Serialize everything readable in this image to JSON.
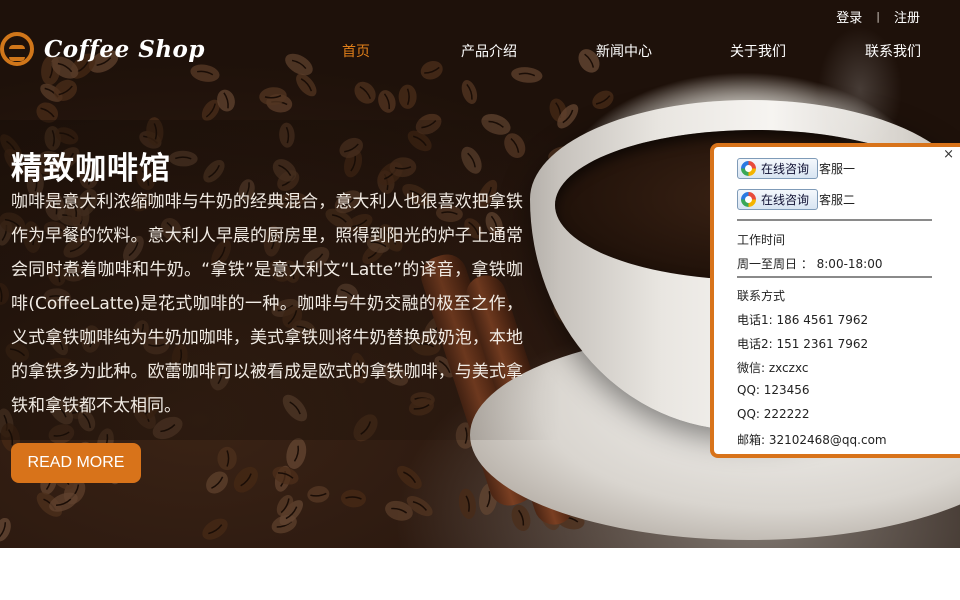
{
  "top_links": {
    "login": "登录",
    "separator": "|",
    "register": "注册"
  },
  "logo": {
    "text": "Coffee Shop",
    "icon": "coffee-logo-icon"
  },
  "nav": {
    "items": [
      {
        "label": "首页",
        "active": true
      },
      {
        "label": "产品介绍",
        "active": false
      },
      {
        "label": "新闻中心",
        "active": false
      },
      {
        "label": "关于我们",
        "active": false
      },
      {
        "label": "联系我们",
        "active": false
      }
    ]
  },
  "hero": {
    "title": "精致咖啡馆",
    "description": "咖啡是意大利浓缩咖啡与牛奶的经典混合，意大利人也很喜欢把拿铁作为早餐的饮料。意大利人早晨的厨房里，照得到阳光的炉子上通常会同时煮着咖啡和牛奶。“拿铁”是意大利文“Latte”的译音，拿铁咖啡(CoffeeLatte)是花式咖啡的一种。咖啡与牛奶交融的极至之作，义式拿铁咖啡纯为牛奶加咖啡，美式拿铁则将牛奶替换成奶泡，本地的拿铁多为此种。欧蕾咖啡可以被看成是欧式的拿铁咖啡，与美式拿铁和拿铁都不太相同。",
    "button": "READ MORE"
  },
  "service": {
    "close": "×",
    "consult_label": "在线咨询",
    "agents": [
      "客服一",
      "客服二"
    ],
    "hours_title": "工作时间",
    "hours": "周一至周日 ： 8:00-18:00",
    "contact_title": "联系方式",
    "phone1": "电话1:   186 4561 7962",
    "phone2": "电话2:   151 2361 7962",
    "wechat": "微信:    zxczxc",
    "qq1": "QQ:  123456",
    "qq2": "QQ:  222222",
    "email": "邮箱:  32102468@qq.com"
  },
  "colors": {
    "accent": "#d8731a",
    "nav_active": "#e07f1a"
  }
}
